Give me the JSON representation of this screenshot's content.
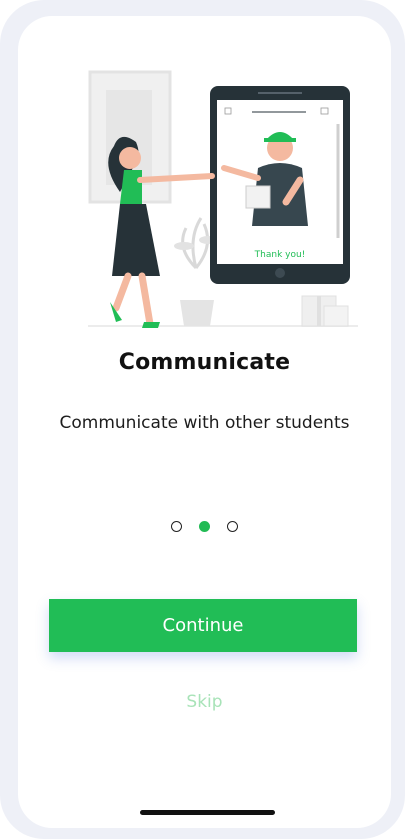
{
  "onboarding": {
    "title": "Communicate",
    "subtitle": "Communicate with other students",
    "illustration_caption": "Thank you!",
    "pagination": {
      "total": 3,
      "active_index": 1
    },
    "continue_label": "Continue",
    "skip_label": "Skip"
  },
  "colors": {
    "accent": "#21bd56",
    "skip_text": "#a8e3b8",
    "title_text": "#111111"
  }
}
